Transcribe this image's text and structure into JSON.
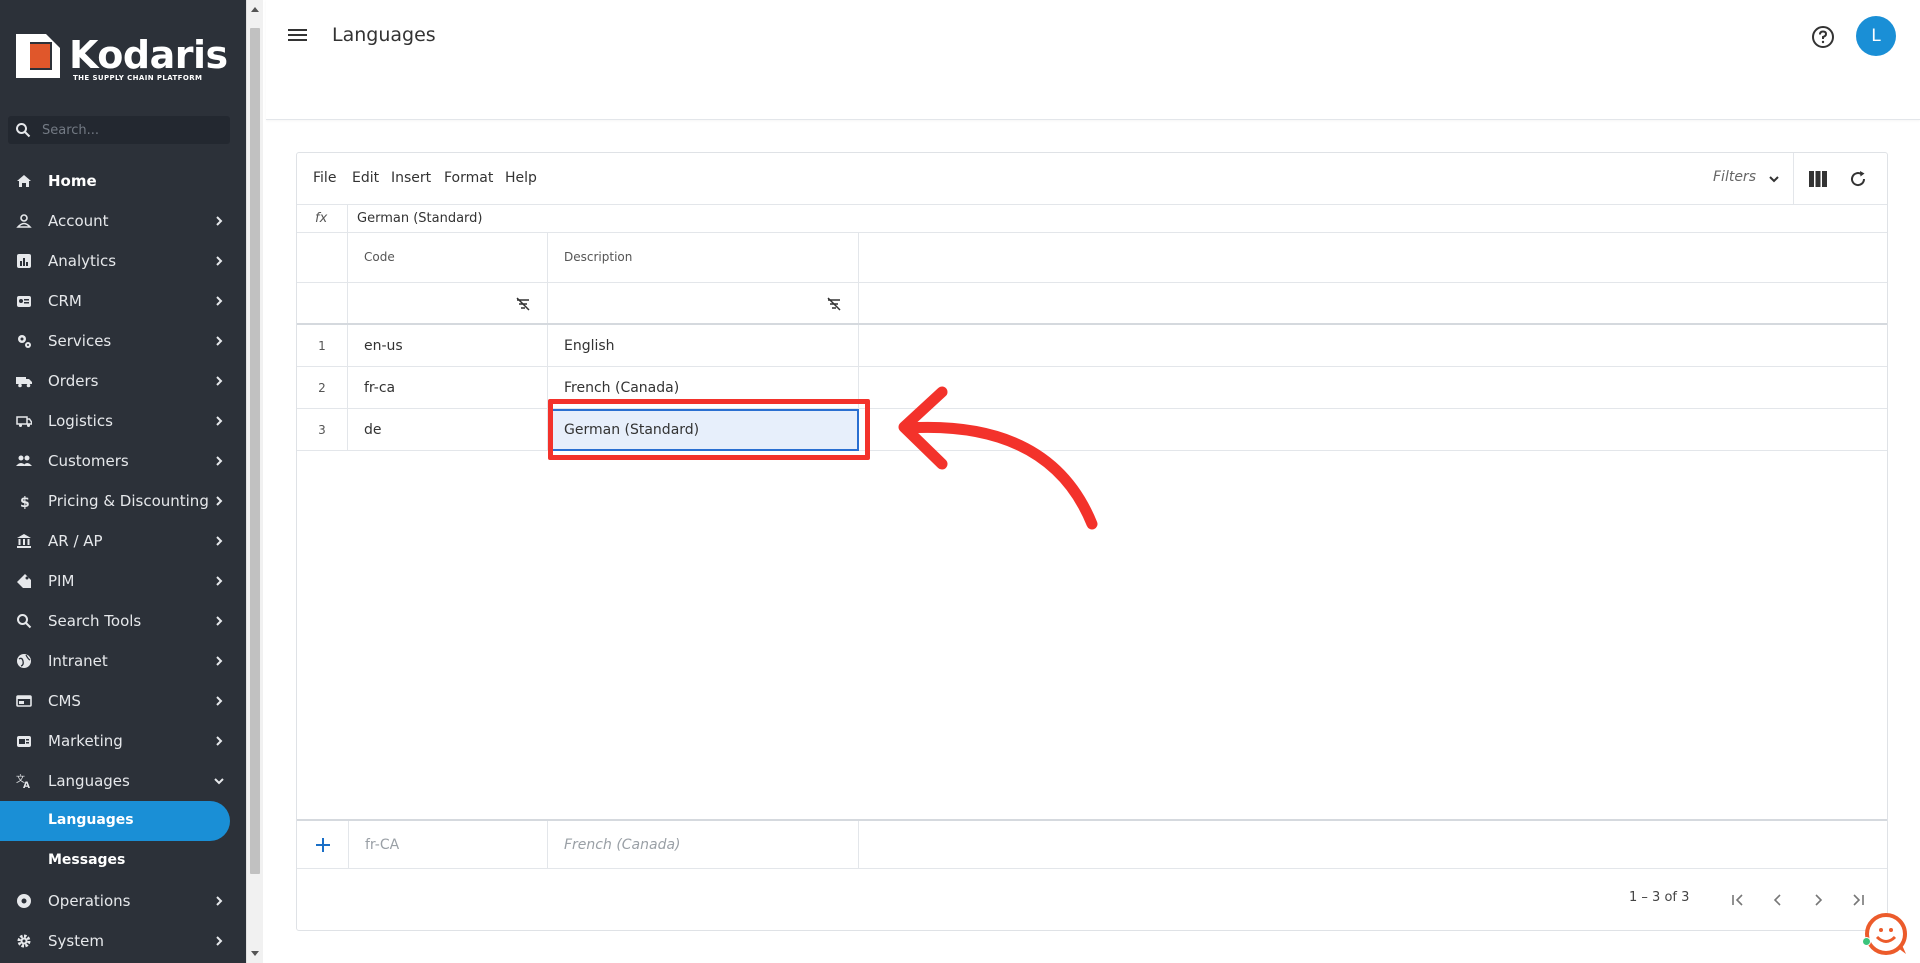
{
  "brand": {
    "name": "Kodaris",
    "tagline": "THE SUPPLY CHAIN PLATFORM"
  },
  "sidebar": {
    "search_placeholder": "Search...",
    "items": [
      {
        "label": "Home",
        "icon": "home-icon"
      },
      {
        "label": "Account",
        "icon": "account-icon"
      },
      {
        "label": "Analytics",
        "icon": "analytics-icon"
      },
      {
        "label": "CRM",
        "icon": "crm-icon"
      },
      {
        "label": "Services",
        "icon": "services-icon"
      },
      {
        "label": "Orders",
        "icon": "truck-icon"
      },
      {
        "label": "Logistics",
        "icon": "logistics-icon"
      },
      {
        "label": "Customers",
        "icon": "customers-icon"
      },
      {
        "label": "Pricing & Discounting",
        "icon": "dollar-icon"
      },
      {
        "label": "AR / AP",
        "icon": "bank-icon"
      },
      {
        "label": "PIM",
        "icon": "tag-icon"
      },
      {
        "label": "Search Tools",
        "icon": "search-icon"
      },
      {
        "label": "Intranet",
        "icon": "globe-icon"
      },
      {
        "label": "CMS",
        "icon": "cms-icon"
      },
      {
        "label": "Marketing",
        "icon": "marketing-icon"
      },
      {
        "label": "Languages",
        "icon": "translate-icon"
      }
    ],
    "sub_items": [
      {
        "label": "Languages",
        "active": true
      },
      {
        "label": "Messages",
        "active": false
      }
    ],
    "bottom_items": [
      {
        "label": "Operations",
        "icon": "operations-icon"
      },
      {
        "label": "System",
        "icon": "gear-icon"
      }
    ]
  },
  "header": {
    "title": "Languages",
    "avatar_initial": "L"
  },
  "menubar": {
    "items": [
      "File",
      "Edit",
      "Insert",
      "Format",
      "Help"
    ],
    "filters_label": "Filters"
  },
  "formula_bar": {
    "label": "fx",
    "value": "German (Standard)"
  },
  "grid": {
    "columns": [
      "Code",
      "Description"
    ],
    "rows": [
      {
        "num": "1",
        "code": "en-us",
        "description": "English"
      },
      {
        "num": "2",
        "code": "fr-ca",
        "description": "French (Canada)"
      },
      {
        "num": "3",
        "code": "de",
        "description": "German (Standard)"
      }
    ],
    "selected_row": 3,
    "new_row_placeholders": {
      "code": "fr-CA",
      "description": "French (Canada)"
    }
  },
  "pager": {
    "info": "1 – 3 of 3"
  },
  "colors": {
    "accent": "#1a8fd6",
    "sidebar_bg": "#2c3139",
    "annotation": "#f3322b",
    "selection": "#e7effb"
  }
}
